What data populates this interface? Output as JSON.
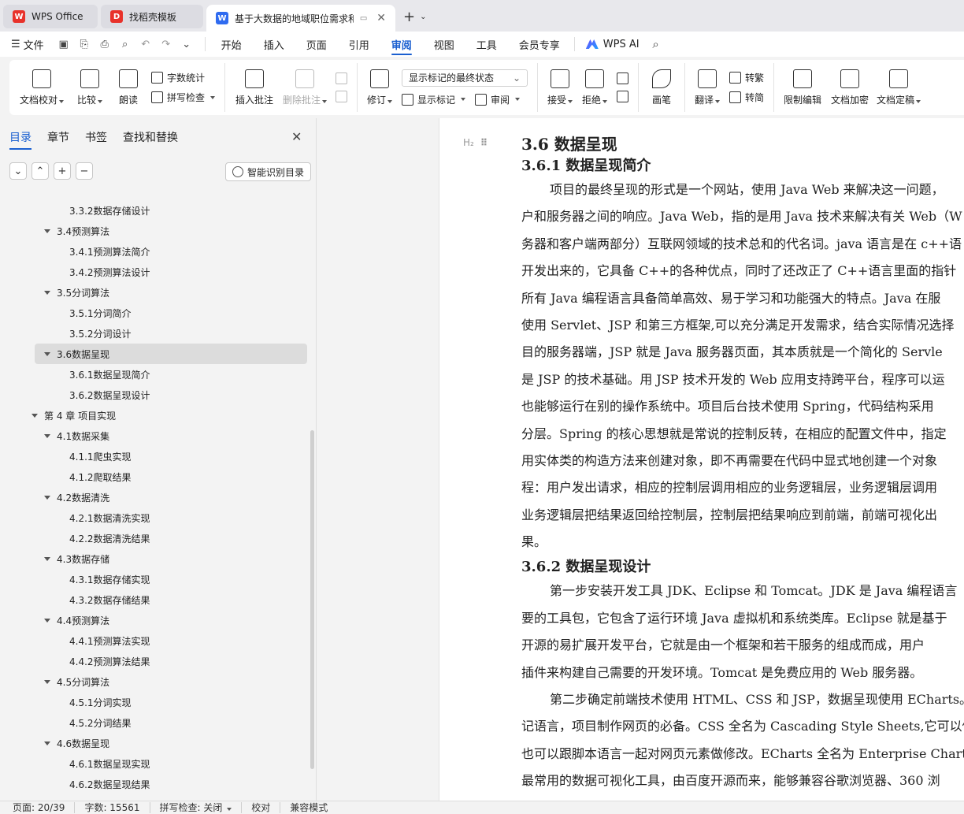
{
  "tabs": [
    {
      "label": "WPS Office",
      "logo": "W",
      "color": "#e8322b"
    },
    {
      "label": "找稻壳模板",
      "logo": "D",
      "color": "#e8322b"
    },
    {
      "label": "基于大数据的地域职位需求和薪",
      "logo": "W",
      "color": "#2f6bf0"
    }
  ],
  "menubar": {
    "file_label": "文件",
    "tabs": [
      "开始",
      "插入",
      "页面",
      "引用",
      "审阅",
      "视图",
      "工具",
      "会员专享"
    ],
    "active_tab": "审阅",
    "ai_label": "WPS AI"
  },
  "ribbon": {
    "doc_check": "文档校对",
    "compare": "比较",
    "read_aloud": "朗读",
    "word_count": "字数统计",
    "spell_check": "拼写检查",
    "insert_comment": "插入批注",
    "delete_comment": "删除批注",
    "revise": "修订",
    "markup_select": "显示标记的最终状态",
    "show_markup": "显示标记",
    "review": "审阅",
    "accept": "接受",
    "reject": "拒绝",
    "pen": "画笔",
    "translate": "翻译",
    "to_traditional": "转繁",
    "to_simplified": "转简",
    "restrict_edit": "限制编辑",
    "encrypt": "文档加密",
    "finalize": "文档定稿"
  },
  "nav": {
    "tabs": [
      "目录",
      "章节",
      "书签",
      "查找和替换"
    ],
    "active_tab": "目录",
    "smart_toc": "智能识别目录",
    "items": [
      {
        "text": "3.3.2数据存储设计",
        "level": 3,
        "arrow": false,
        "selected": false
      },
      {
        "text": "3.4预测算法",
        "level": 2,
        "arrow": true,
        "selected": false
      },
      {
        "text": "3.4.1预测算法简介",
        "level": 3,
        "arrow": false,
        "selected": false
      },
      {
        "text": "3.4.2预测算法设计",
        "level": 3,
        "arrow": false,
        "selected": false
      },
      {
        "text": "3.5分词算法",
        "level": 2,
        "arrow": true,
        "selected": false
      },
      {
        "text": "3.5.1分词简介",
        "level": 3,
        "arrow": false,
        "selected": false
      },
      {
        "text": "3.5.2分词设计",
        "level": 3,
        "arrow": false,
        "selected": false
      },
      {
        "text": "3.6数据呈现",
        "level": 2,
        "arrow": true,
        "selected": true
      },
      {
        "text": "3.6.1数据呈现简介",
        "level": 3,
        "arrow": false,
        "selected": false
      },
      {
        "text": "3.6.2数据呈现设计",
        "level": 3,
        "arrow": false,
        "selected": false
      },
      {
        "text": "第 4 章  项目实现",
        "level": 1,
        "arrow": true,
        "selected": false
      },
      {
        "text": "4.1数据采集",
        "level": 2,
        "arrow": true,
        "selected": false
      },
      {
        "text": "4.1.1爬虫实现",
        "level": 3,
        "arrow": false,
        "selected": false
      },
      {
        "text": "4.1.2爬取结果",
        "level": 3,
        "arrow": false,
        "selected": false
      },
      {
        "text": "4.2数据清洗",
        "level": 2,
        "arrow": true,
        "selected": false
      },
      {
        "text": "4.2.1数据清洗实现",
        "level": 3,
        "arrow": false,
        "selected": false
      },
      {
        "text": "4.2.2数据清洗结果",
        "level": 3,
        "arrow": false,
        "selected": false
      },
      {
        "text": "4.3数据存储",
        "level": 2,
        "arrow": true,
        "selected": false
      },
      {
        "text": "4.3.1数据存储实现",
        "level": 3,
        "arrow": false,
        "selected": false
      },
      {
        "text": "4.3.2数据存储结果",
        "level": 3,
        "arrow": false,
        "selected": false
      },
      {
        "text": "4.4预测算法",
        "level": 2,
        "arrow": true,
        "selected": false
      },
      {
        "text": "4.4.1预测算法实现",
        "level": 3,
        "arrow": false,
        "selected": false
      },
      {
        "text": "4.4.2预测算法结果",
        "level": 3,
        "arrow": false,
        "selected": false
      },
      {
        "text": "4.5分词算法",
        "level": 2,
        "arrow": true,
        "selected": false
      },
      {
        "text": "4.5.1分词实现",
        "level": 3,
        "arrow": false,
        "selected": false
      },
      {
        "text": "4.5.2分词结果",
        "level": 3,
        "arrow": false,
        "selected": false
      },
      {
        "text": "4.6数据呈现",
        "level": 2,
        "arrow": true,
        "selected": false
      },
      {
        "text": "4.6.1数据呈现实现",
        "level": 3,
        "arrow": false,
        "selected": false
      },
      {
        "text": "4.6.2数据呈现结果",
        "level": 3,
        "arrow": false,
        "selected": false
      }
    ]
  },
  "doc": {
    "heading_marker": "H₂",
    "h2": "3.6  数据呈现",
    "h3_1": "3.6.1  数据呈现简介",
    "para1": [
      "项目的最终呈现的形式是一个网站，使用 Java Web 来解决这一问题，",
      "户和服务器之间的响应。Java Web，指的是用 Java 技术来解决有关 Web（W",
      "务器和客户端两部分）互联网领域的技术总和的代名词。java 语言是在 c++语",
      "开发出来的，它具备 C++的各种优点，同时了还改正了 C++语言里面的指针",
      "所有 Java 编程语言具备简单高效、易于学习和功能强大的特点。Java 在服",
      "使用 Servlet、JSP 和第三方框架,可以充分满足开发需求，结合实际情况选择",
      "目的服务器端，JSP 就是 Java 服务器页面，其本质就是一个简化的 Servle",
      "是 JSP 的技术基础。用 JSP 技术开发的 Web 应用支持跨平台，程序可以运",
      "也能够运行在别的操作系统中。项目后台技术使用 Spring，代码结构采用",
      "分层。Spring 的核心思想就是常说的控制反转，在相应的配置文件中，指定",
      "用实体类的构造方法来创建对象，即不再需要在代码中显式地创建一个对象",
      "程：用户发出请求，相应的控制层调用相应的业务逻辑层，业务逻辑层调用",
      "业务逻辑层把结果返回给控制层，控制层把结果响应到前端，前端可视化出",
      "果。"
    ],
    "h3_2": "3.6.2  数据呈现设计",
    "para2": [
      "第一步安装开发工具 JDK、Eclipse 和 Tomcat。JDK 是 Java 编程语言",
      "要的工具包，它包含了运行环境 Java 虚拟机和系统类库。Eclipse 就是基于",
      "开源的易扩展开发平台，它就是由一个框架和若干服务的组成而成，用户",
      "插件来构建自己需要的开发环境。Tomcat 是免费应用的 Web 服务器。"
    ],
    "para3": [
      "第二步确定前端技术使用 HTML、CSS 和 JSP，数据呈现使用 ECharts。",
      "记语言，项目制作网页的必备。CSS 全名为 Cascading Style Sheets,它可以修",
      "也可以跟脚本语言一起对网页元素做修改。ECharts 全名为 Enterprise Charts",
      "最常用的数据可视化工具，由百度开源而来，能够兼容谷歌浏览器、360 浏"
    ]
  },
  "status": {
    "page": "页面: 20/39",
    "words": "字数: 15561",
    "spell": "拼写检查: 关闭",
    "proof": "校对",
    "compat": "兼容模式"
  }
}
